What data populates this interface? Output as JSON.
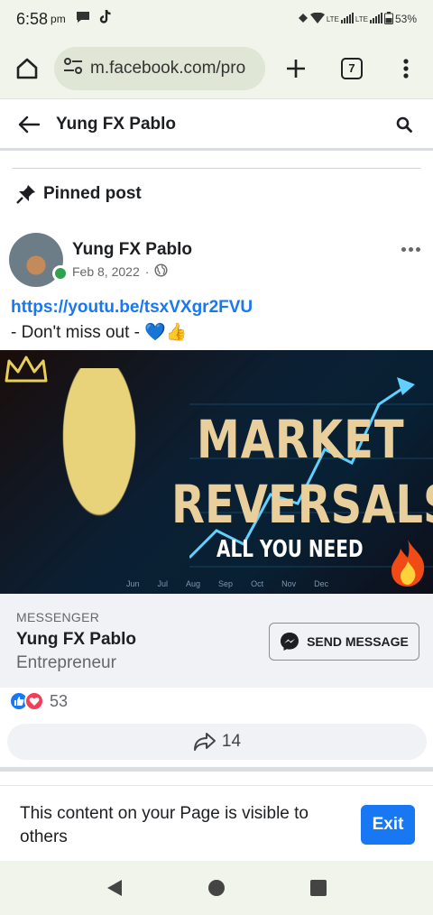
{
  "status_bar": {
    "time": "6:58",
    "ampm": "pm",
    "network": "LTE",
    "network2": "LTE",
    "battery": "53%"
  },
  "browser": {
    "url": "m.facebook.com/pro",
    "tab_count": "7"
  },
  "header": {
    "title": "Yung FX Pablo"
  },
  "pinned": {
    "label": "Pinned post"
  },
  "post": {
    "author": "Yung FX Pablo",
    "date": "Feb 8, 2022",
    "separator": "·",
    "link": "https://youtu.be/tsxVXgr2FVU",
    "text": "- Don't miss out - 💙👍",
    "image": {
      "line1": "MARKET",
      "line2": "REVERSALS",
      "line3": "ALL YOU NEED",
      "months": [
        "Jun",
        "Jul",
        "Aug",
        "Sep",
        "Oct",
        "Nov",
        "Dec"
      ]
    }
  },
  "messenger": {
    "kicker": "MESSENGER",
    "name": "Yung FX Pablo",
    "role": "Entrepreneur",
    "button": "SEND MESSAGE"
  },
  "reactions": {
    "count": "53"
  },
  "share": {
    "count": "14"
  },
  "notice": {
    "message": "This content on your Page is visible to others",
    "exit": "Exit"
  },
  "colors": {
    "brand": "#1877f2",
    "online": "#31a24c",
    "love": "#f33e58"
  }
}
